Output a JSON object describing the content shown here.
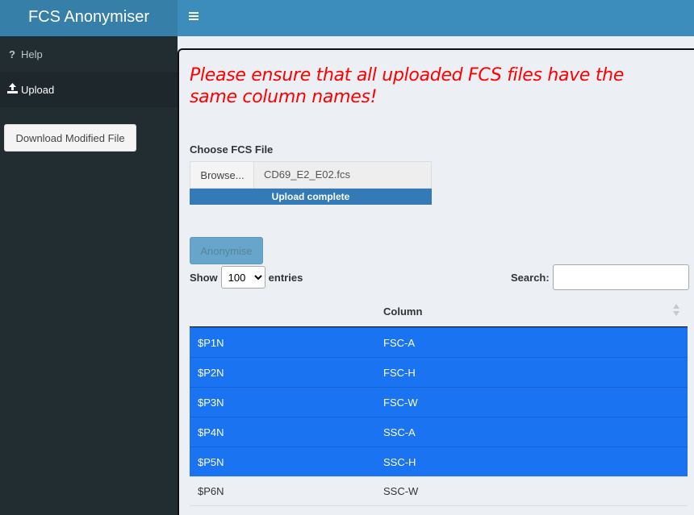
{
  "header": {
    "brand": "FCS Anonymiser",
    "menu_icon": "hamburger-icon"
  },
  "sidebar": {
    "items": [
      {
        "icon": "question-icon",
        "label": "Help",
        "active": false
      },
      {
        "icon": "upload-icon",
        "label": "Upload",
        "active": true
      }
    ],
    "download_button": "Download Modified File"
  },
  "main": {
    "warning": "Please ensure that all uploaded FCS files have the same column names!",
    "file_input": {
      "label": "Choose FCS File",
      "browse_label": "Browse...",
      "file_name": "CD69_E2_E02.fcs",
      "progress_text": "Upload complete",
      "progress": 1.0
    },
    "anonymise_button": "Anonymise",
    "table_controls": {
      "show_label": "Show",
      "entries_value": "100",
      "entries_label": "entries",
      "search_label": "Search:"
    },
    "table": {
      "columns": [
        "",
        "Column"
      ],
      "rows": [
        {
          "key": "$P1N",
          "value": "FSC-A",
          "selected": true
        },
        {
          "key": "$P2N",
          "value": "FSC-H",
          "selected": true
        },
        {
          "key": "$P3N",
          "value": "FSC-W",
          "selected": true
        },
        {
          "key": "$P4N",
          "value": "SSC-A",
          "selected": true
        },
        {
          "key": "$P5N",
          "value": "SSC-H",
          "selected": true
        },
        {
          "key": "$P6N",
          "value": "SSC-W",
          "selected": false
        }
      ]
    }
  },
  "colors": {
    "header": "#3c8dbc",
    "brand": "#367fa9",
    "sidebar": "#222d32",
    "warning": "#ff0000",
    "selected_row": "#1a73f0"
  }
}
